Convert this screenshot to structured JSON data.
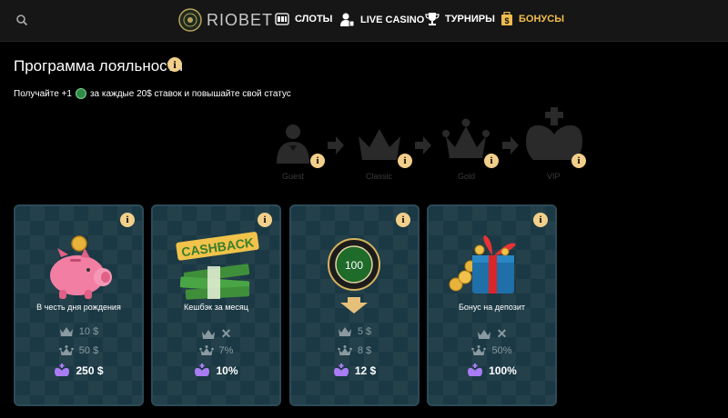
{
  "header": {
    "logo_text": "RIOBET",
    "nav": [
      {
        "label": "СЛОТЫ",
        "icon": "slots-icon"
      },
      {
        "label": "LIVE CASINO",
        "icon": "dealer-icon"
      },
      {
        "label": "ТУРНИРЫ",
        "icon": "trophy-icon"
      },
      {
        "label": "БОНУСЫ",
        "icon": "bonus-icon",
        "active": true
      }
    ],
    "accent_color": "#f2bd4c"
  },
  "page": {
    "title": "Программа лояльности",
    "subtitle_prefix": "Получайте +1",
    "subtitle_suffix": "за каждые 20$ ставок и повышайте свой статус"
  },
  "statuses": [
    {
      "name": "Guest",
      "icon": "guest-icon"
    },
    {
      "name": "Classic",
      "icon": "crown-icon"
    },
    {
      "name": "Gold",
      "icon": "gold-crown-icon"
    },
    {
      "name": "VIP",
      "icon": "king-crown-icon"
    }
  ],
  "cards": [
    {
      "label": "В честь дня рождения",
      "art": "piggy-bank-icon",
      "classic": "10 $",
      "gold": "50 $",
      "vip": "250 $"
    },
    {
      "label": "Кешбэк за месяц",
      "art": "cashback-icon",
      "art_text": "CASHBACK",
      "classic": "✕",
      "gold": "7%",
      "vip": "10%"
    },
    {
      "label": "",
      "art": "chip-icon",
      "chip_value": "100",
      "classic": "5 $",
      "gold": "8 $",
      "vip": "12 $"
    },
    {
      "label": "Бонус на депозит",
      "art": "gift-icon",
      "classic": "✕",
      "gold": "50%",
      "vip": "100%"
    }
  ],
  "info_glyph": "i"
}
